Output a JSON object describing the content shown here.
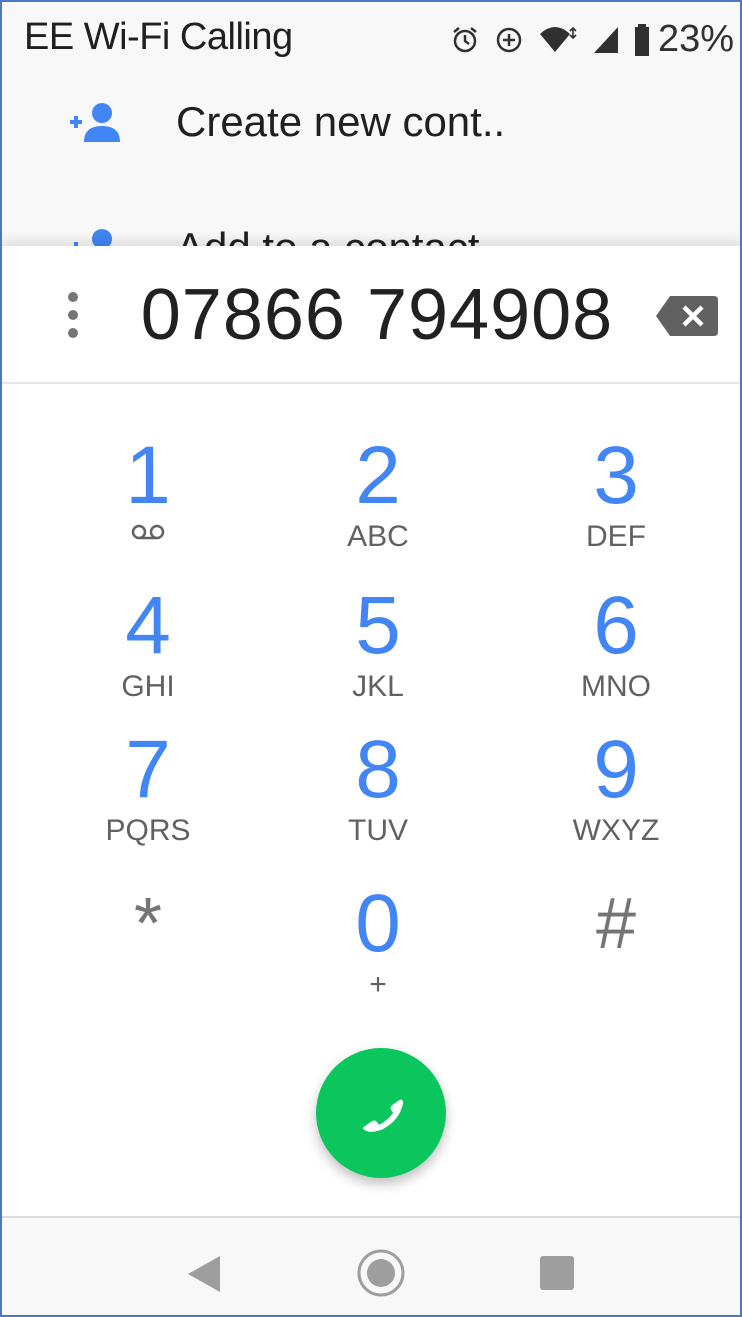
{
  "status_bar": {
    "carrier": "EE Wi-Fi Calling",
    "battery_percent": "23%",
    "icons": [
      "alarm-icon",
      "data-saver-icon",
      "wifi-icon",
      "signal-icon",
      "battery-icon"
    ]
  },
  "suggestions": [
    {
      "label": "Create new cont..",
      "icon": "add-contact-icon"
    },
    {
      "label": "Add to a contact",
      "icon": "add-contact-icon"
    }
  ],
  "dialer": {
    "number": "07866 794908",
    "overflow_icon": "more-vert-icon",
    "backspace_icon": "backspace-icon"
  },
  "keypad": {
    "keys": [
      {
        "digit": "1",
        "letters": ""
      },
      {
        "digit": "2",
        "letters": "ABC"
      },
      {
        "digit": "3",
        "letters": "DEF"
      },
      {
        "digit": "4",
        "letters": "GHI"
      },
      {
        "digit": "5",
        "letters": "JKL"
      },
      {
        "digit": "6",
        "letters": "MNO"
      },
      {
        "digit": "7",
        "letters": "PQRS"
      },
      {
        "digit": "8",
        "letters": "TUV"
      },
      {
        "digit": "9",
        "letters": "WXYZ"
      },
      {
        "digit": "*",
        "letters": ""
      },
      {
        "digit": "0",
        "letters": "+"
      },
      {
        "digit": "#",
        "letters": ""
      }
    ]
  },
  "call_button": {
    "icon": "phone-icon",
    "color": "#0ac65c"
  },
  "nav": {
    "back": "back-icon",
    "home": "home-icon",
    "recents": "recents-icon"
  },
  "colors": {
    "accent": "#4285f4",
    "call": "#0ac65c"
  }
}
